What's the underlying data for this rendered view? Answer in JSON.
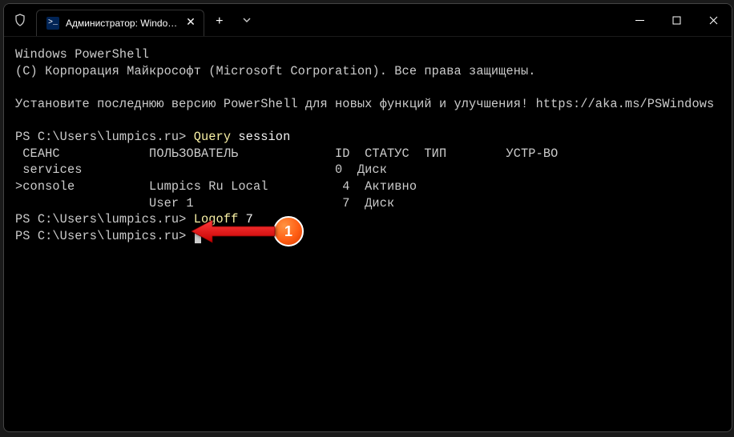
{
  "tab": {
    "title": "Администратор: Windows Po"
  },
  "terminal": {
    "line1": "Windows PowerShell",
    "line2": "(С) Корпорация Майкрософт (Microsoft Corporation). Все права защищены.",
    "line3": "Установите последнюю версию PowerShell для новых функций и улучшения! https://aka.ms/PSWindows",
    "prompt1": "PS C:\\Users\\lumpics.ru> ",
    "cmd1a": "Query",
    "cmd1b": " session",
    "header": " СЕАНС            ПОЛЬЗОВАТЕЛЬ             ID  СТАТУС  ТИП        УСТР-ВО",
    "row1": " services                                  0  Диск",
    "row2": ">console          Lumpics Ru Local          4  Активно",
    "row3": "                  User 1                    7  Диск",
    "prompt2": "PS C:\\Users\\lumpics.ru> ",
    "cmd2a": "Logoff",
    "cmd2b": " 7",
    "prompt3": "PS C:\\Users\\lumpics.ru> "
  },
  "annotation": {
    "label": "1"
  }
}
